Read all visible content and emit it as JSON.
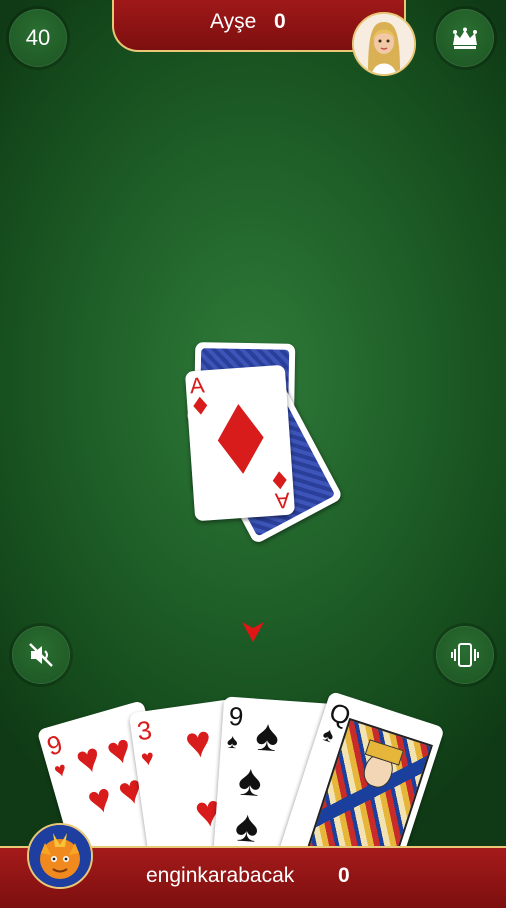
{
  "hud": {
    "counter": "40",
    "opponent_name": "Ayşe",
    "opponent_score": "0",
    "player_name": "enginkarabacak",
    "player_score": "0"
  },
  "table_pile": {
    "top_card": {
      "rank": "A",
      "suit": "diamonds",
      "color": "#d81b1b"
    },
    "back_color": "#2a3f9a"
  },
  "hand": [
    {
      "rank": "9",
      "suit": "hearts"
    },
    {
      "rank": "3",
      "suit": "hearts"
    },
    {
      "rank": "9",
      "suit": "spades"
    },
    {
      "rank": "Q",
      "suit": "spades"
    }
  ],
  "colors": {
    "felt": "#1f6028",
    "bar_red": "#a51a1a",
    "gold_trim": "#e8c777"
  },
  "icons": [
    "crown-icon",
    "mute-icon",
    "vibrate-icon",
    "turn-arrow-icon"
  ]
}
